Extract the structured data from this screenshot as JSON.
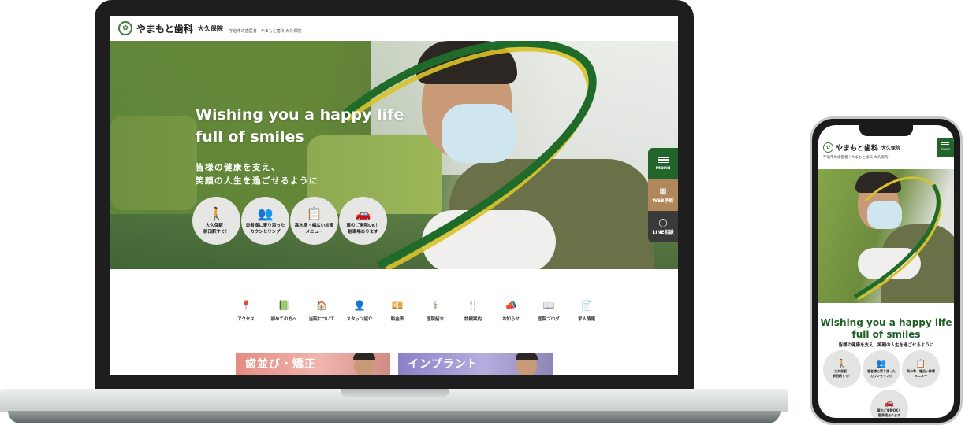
{
  "clinic": {
    "logo_glyph": "✿",
    "name": "やまもと歯科",
    "branch": "大久保院",
    "tagline": "宇治市の歯医者｜やまもと歯科 大久保院"
  },
  "hero": {
    "title_line1": "Wishing you a happy life",
    "title_line2": "full of smiles",
    "subtitle_line1": "皆様の健康を支え、",
    "subtitle_line2": "笑顔の人生を過ごせるように",
    "features": [
      {
        "icon": "walking-person-icon",
        "glyph": "🚶",
        "line1": "大久保駅・",
        "line2": "新田駅すぐ！"
      },
      {
        "icon": "counseling-icon",
        "glyph": "👥",
        "line1": "患者様に寄り添った",
        "line2": "カウンセリング"
      },
      {
        "icon": "clipboard-icon",
        "glyph": "📋",
        "line1": "高水準・幅広い診療",
        "line2": "メニュー"
      },
      {
        "icon": "car-icon",
        "glyph": "🚗",
        "line1": "車のご来院OK！",
        "line2": "駐車場あります"
      }
    ]
  },
  "side_menu": {
    "menu_label": "menu",
    "web_label": "WEB予約",
    "web_glyph": "▦",
    "line_label": "LINE相談",
    "line_glyph": "◯"
  },
  "nav": [
    {
      "icon": "map-pin-icon",
      "glyph": "📍",
      "label": "アクセス"
    },
    {
      "icon": "book-icon",
      "glyph": "📗",
      "label": "初めての方へ"
    },
    {
      "icon": "house-icon",
      "glyph": "🏠",
      "label": "当院について"
    },
    {
      "icon": "staff-icon",
      "glyph": "👤",
      "label": "スタッフ紹介"
    },
    {
      "icon": "money-icon",
      "glyph": "💴",
      "label": "料金表"
    },
    {
      "icon": "hospital-icon",
      "glyph": "⚕",
      "label": "医院紹介"
    },
    {
      "icon": "tools-icon",
      "glyph": "🍴",
      "label": "診療案内"
    },
    {
      "icon": "megaphone-icon",
      "glyph": "📣",
      "label": "お知らせ"
    },
    {
      "icon": "blog-icon",
      "glyph": "📖",
      "label": "医院ブログ"
    },
    {
      "icon": "recruit-icon",
      "glyph": "📄",
      "label": "求人情報"
    }
  ],
  "banners": {
    "orthodontics": "歯並び・矯正",
    "implant": "インプラント"
  },
  "phone": {
    "menu_label": "menu",
    "subtitle": "皆様の健康を支え、笑顔の人生を過ごせるように"
  },
  "colors": {
    "brand_green": "#22652a",
    "web_button": "#b0875a",
    "line_button": "#3a3a3a",
    "arc_yellow": "#d8c22a"
  }
}
